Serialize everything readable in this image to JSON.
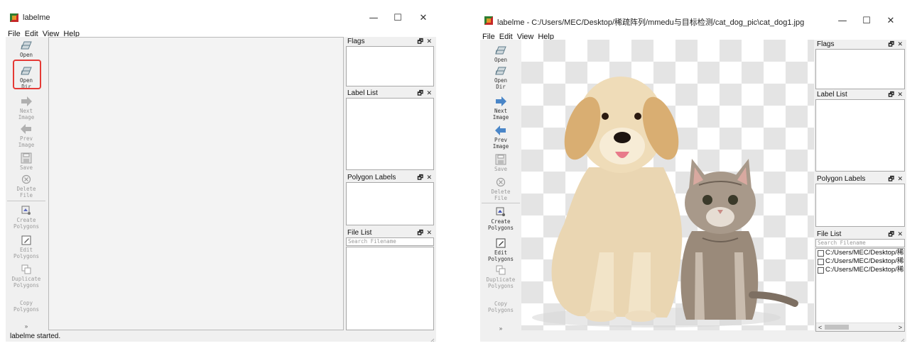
{
  "left_window": {
    "title": "labelme",
    "menu": [
      "File",
      "Edit",
      "View",
      "Help"
    ],
    "tools": [
      {
        "label": "Open",
        "icon": "open-folder-icon",
        "enabled": true
      },
      {
        "label": "Open\nDir",
        "icon": "open-dir-icon",
        "enabled": true,
        "highlighted": true
      },
      {
        "label": "Next\nImage",
        "icon": "next-arrow-icon",
        "enabled": false
      },
      {
        "label": "Prev\nImage",
        "icon": "prev-arrow-icon",
        "enabled": false
      },
      {
        "label": "Save",
        "icon": "save-icon",
        "enabled": false
      },
      {
        "label": "Delete\nFile",
        "icon": "delete-icon",
        "enabled": false
      },
      {
        "label": "Create\nPolygons",
        "icon": "create-polygon-icon",
        "enabled": false
      },
      {
        "label": "Edit\nPolygons",
        "icon": "edit-polygon-icon",
        "enabled": false
      },
      {
        "label": "Duplicate\nPolygons",
        "icon": "duplicate-icon",
        "enabled": false
      },
      {
        "label": "Copy\nPolygons",
        "icon": "copy-icon",
        "enabled": false
      }
    ],
    "docks": {
      "flags": "Flags",
      "label_list": "Label List",
      "polygon_labels": "Polygon Labels",
      "file_list": "File List"
    },
    "search_placeholder": "Search Filename",
    "status": "labelme started.",
    "highlight_color": "#e53935"
  },
  "right_window": {
    "title": "labelme - C:/Users/MEC/Desktop/稀疏阵列/mmedu与目标检测/cat_dog_pic\\cat_dog1.jpg",
    "menu": [
      "File",
      "Edit",
      "View",
      "Help"
    ],
    "tools": [
      {
        "label": "Open",
        "icon": "open-folder-icon",
        "enabled": true
      },
      {
        "label": "Open\nDir",
        "icon": "open-dir-icon",
        "enabled": true
      },
      {
        "label": "Next\nImage",
        "icon": "next-arrow-icon",
        "enabled": true
      },
      {
        "label": "Prev\nImage",
        "icon": "prev-arrow-icon",
        "enabled": true
      },
      {
        "label": "Save",
        "icon": "save-icon",
        "enabled": false
      },
      {
        "label": "Delete\nFile",
        "icon": "delete-icon",
        "enabled": false
      },
      {
        "label": "Create\nPolygons",
        "icon": "create-polygon-icon",
        "enabled": true
      },
      {
        "label": "Edit\nPolygons",
        "icon": "edit-polygon-icon",
        "enabled": true
      },
      {
        "label": "Duplicate\nPolygons",
        "icon": "duplicate-icon",
        "enabled": false
      },
      {
        "label": "Copy\nPolygons",
        "icon": "copy-icon",
        "enabled": false
      }
    ],
    "docks": {
      "flags": "Flags",
      "label_list": "Label List",
      "polygon_labels": "Polygon Labels",
      "file_list": "File List"
    },
    "search_placeholder": "Search Filename",
    "files": [
      "C:/Users/MEC/Desktop/稀",
      "C:/Users/MEC/Desktop/稀",
      "C:/Users/MEC/Desktop/稀"
    ],
    "scroll_left": "<",
    "scroll_right": ">"
  },
  "window_controls": {
    "minimize": "—",
    "maximize": "☐",
    "close": "✕"
  },
  "dock_controls": {
    "float": "🗗",
    "close": "✕"
  },
  "more_tools": "»"
}
